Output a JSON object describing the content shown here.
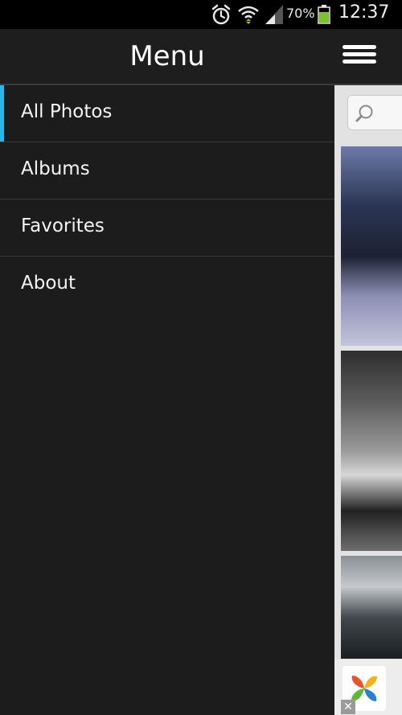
{
  "status_bar": {
    "battery_percent": "70%",
    "time": "12:37",
    "icons": [
      "alarm-icon",
      "wifi-icon",
      "signal-icon",
      "battery-icon"
    ]
  },
  "drawer": {
    "title": "Menu",
    "menu_icon": "hamburger-icon",
    "items": [
      {
        "label": "All Photos",
        "active": true
      },
      {
        "label": "Albums",
        "active": false
      },
      {
        "label": "Favorites",
        "active": false
      },
      {
        "label": "About",
        "active": false
      }
    ]
  },
  "content": {
    "search_icon": "search-icon",
    "thumbnails": [
      "car-photo",
      "car-photo",
      "car-photo"
    ]
  },
  "colors": {
    "accent": "#29b6e8",
    "drawer_background": "#1c1c1c",
    "battery_fill": "#7cc32a"
  }
}
